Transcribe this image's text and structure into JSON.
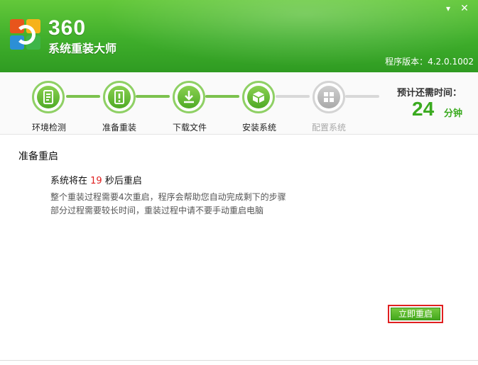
{
  "window": {
    "minimize_icon": "minimize-icon",
    "close_icon": "close-icon",
    "min_glyph": "▾",
    "close_glyph": "✕"
  },
  "brand": {
    "number": "360",
    "subtitle": "系统重装大师",
    "logo_icon": "360-logo-icon"
  },
  "version": "程序版本：4.2.0.1002",
  "steps": [
    {
      "label": "环境检测",
      "state": "done",
      "icon": "document-check-icon"
    },
    {
      "label": "准备重装",
      "state": "done",
      "icon": "alert-file-icon"
    },
    {
      "label": "下载文件",
      "state": "done",
      "icon": "download-icon"
    },
    {
      "label": "安装系统",
      "state": "current",
      "icon": "install-box-icon"
    },
    {
      "label": "配置系统",
      "state": "pending",
      "icon": "windows-logo-icon"
    }
  ],
  "remaining": {
    "label": "预计还需时间：",
    "value": "24",
    "unit": "分钟"
  },
  "content": {
    "title": "准备重启",
    "countdown_prefix": "系统将在 ",
    "countdown_seconds": "19",
    "countdown_suffix": " 秒后重启",
    "info_line1": "整个重装过程需要4次重启，程序会帮助您自动完成剩下的步骤",
    "info_line2": "部分过程需要较长时间，重装过程中请不要手动重启电脑"
  },
  "buttons": {
    "restart_now": "立即重启"
  },
  "colors": {
    "header_green": "#3fae2b",
    "accent_green": "#3aaa1f",
    "highlight_red": "#e02020",
    "inactive_gray": "#a8a8a8"
  }
}
